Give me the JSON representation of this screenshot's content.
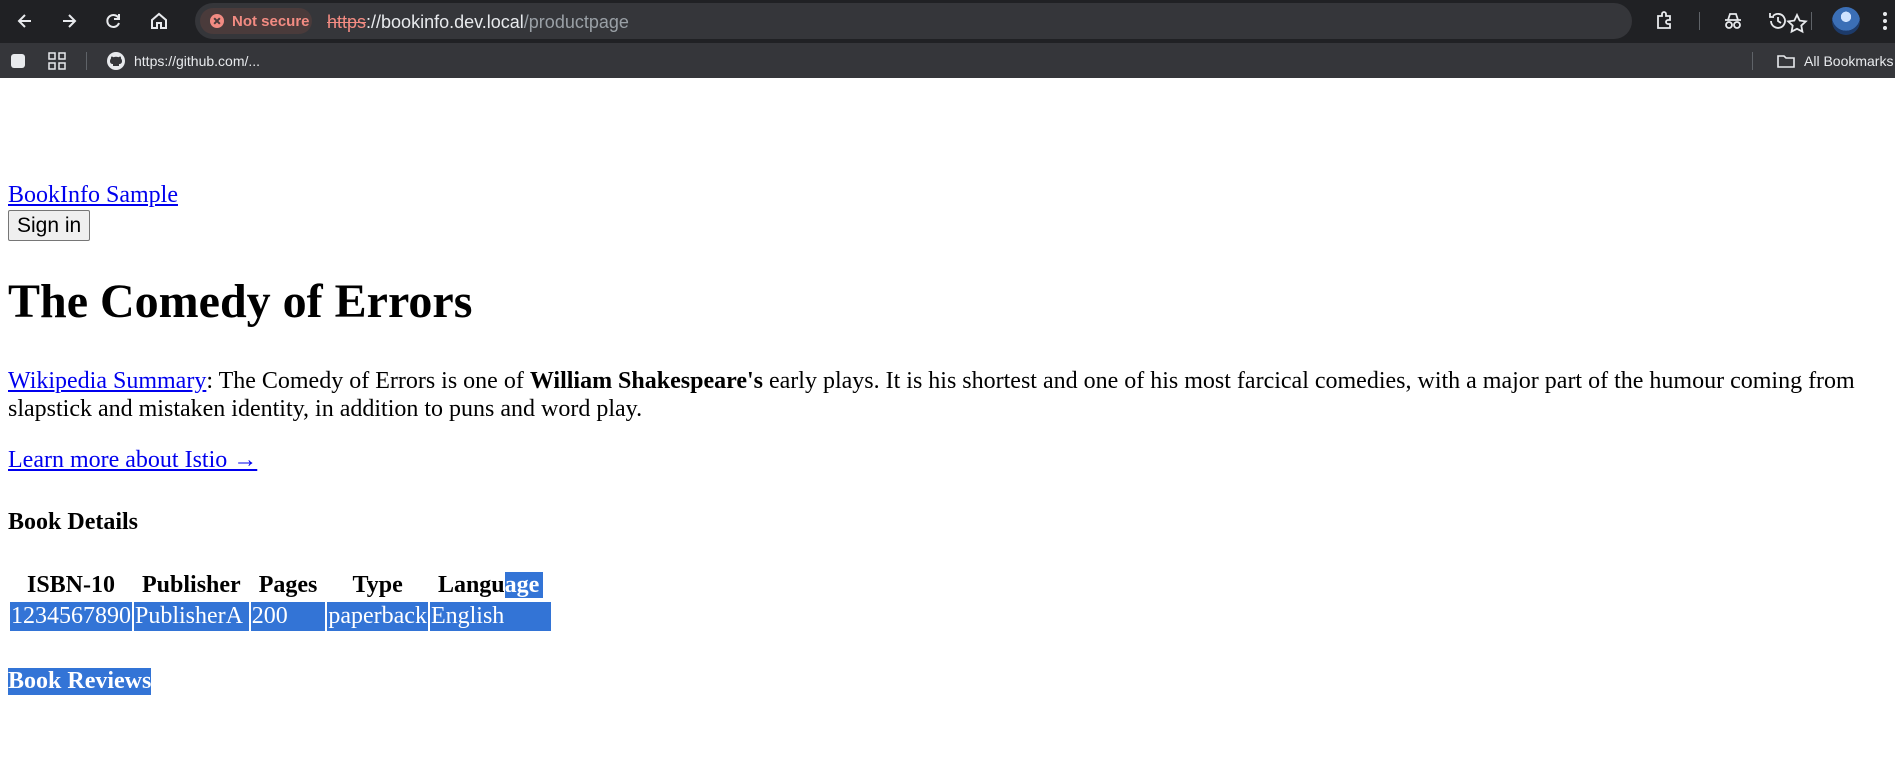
{
  "browser": {
    "security_label": "Not secure",
    "url_scheme": "https",
    "url_rest_host": "://bookinfo.dev.local",
    "url_path": "/productpage",
    "bookmark_github": "https://github.com/...",
    "bookmark_all": "All Bookmarks"
  },
  "page": {
    "brand": "BookInfo Sample",
    "signin_label": "Sign in",
    "title": "The Comedy of Errors",
    "summary_link": "Wikipedia Summary",
    "summary_pre": ": The Comedy of Errors is one of ",
    "summary_bold": "William Shakespeare's",
    "summary_post": " early plays. It is his shortest and one of his most farcical comedies, with a major part of the humour coming from slapstick and mistaken identity, in addition to puns and word play.",
    "istio_link": "Learn more about Istio →",
    "details_heading": "Book Details",
    "table": {
      "headers": [
        "ISBN-10",
        "Publisher",
        "Pages",
        "Type",
        "Langu",
        "age"
      ],
      "row": [
        "1234567890",
        "PublisherA",
        "200",
        "paperback",
        "English"
      ]
    },
    "reviews_heading": "Book Reviews"
  },
  "colors": {
    "selection": "#3374d6",
    "link": "#0000ee",
    "chrome_dark": "#202124",
    "chrome_bar": "#35363a"
  }
}
